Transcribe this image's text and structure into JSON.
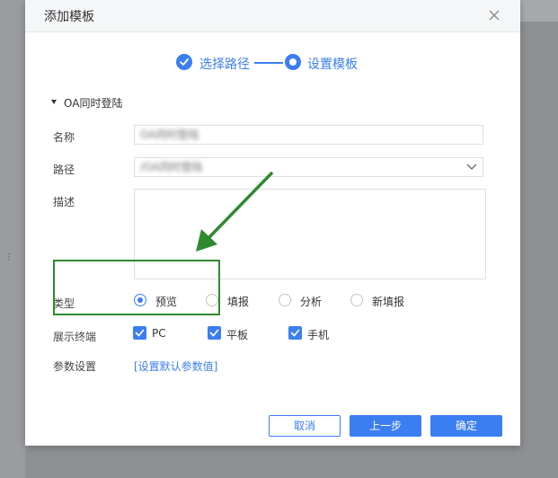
{
  "dialog": {
    "title": "添加模板",
    "close_icon": "close-icon"
  },
  "steps": [
    {
      "label": "选择路径",
      "state": "done",
      "icon": "check-circle-icon"
    },
    {
      "label": "设置模板",
      "state": "active",
      "icon": "dot-circle-icon"
    }
  ],
  "section": {
    "label": "OA同时登陆",
    "icon": "caret-down-icon"
  },
  "form": {
    "name_label": "名称",
    "name_value": "OA同时登陆",
    "path_label": "路径",
    "path_value": "/OA同时登陆",
    "path_icon": "chevron-down-icon",
    "desc_label": "描述",
    "desc_value": "",
    "type_label": "类型",
    "type_options": [
      "预览",
      "填报",
      "分析",
      "新填报"
    ],
    "type_selected": "预览",
    "terminal_label": "展示终端",
    "terminal_options": [
      "PC",
      "平板",
      "手机"
    ],
    "terminal_checked": [
      true,
      true,
      true
    ],
    "params_label": "参数设置",
    "params_link": "[设置默认参数值]"
  },
  "buttons": {
    "cancel": "取消",
    "prev": "上一步",
    "confirm": "确定"
  },
  "colors": {
    "accent": "#3b7ef1",
    "annotation": "#2f8a2f"
  }
}
